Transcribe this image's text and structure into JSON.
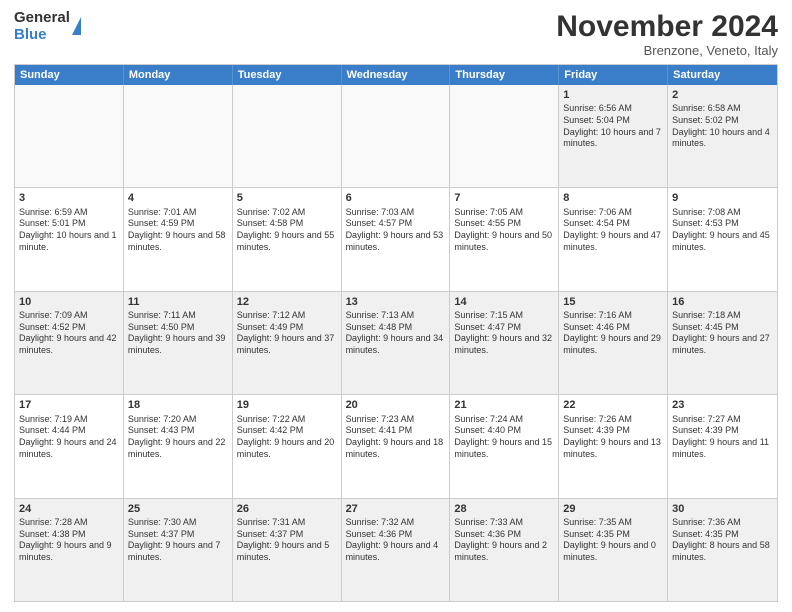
{
  "header": {
    "logo_general": "General",
    "logo_blue": "Blue",
    "month_title": "November 2024",
    "subtitle": "Brenzone, Veneto, Italy"
  },
  "calendar": {
    "days": [
      "Sunday",
      "Monday",
      "Tuesday",
      "Wednesday",
      "Thursday",
      "Friday",
      "Saturday"
    ],
    "rows": [
      [
        {
          "day": "",
          "info": ""
        },
        {
          "day": "",
          "info": ""
        },
        {
          "day": "",
          "info": ""
        },
        {
          "day": "",
          "info": ""
        },
        {
          "day": "",
          "info": ""
        },
        {
          "day": "1",
          "info": "Sunrise: 6:56 AM\nSunset: 5:04 PM\nDaylight: 10 hours and 7 minutes."
        },
        {
          "day": "2",
          "info": "Sunrise: 6:58 AM\nSunset: 5:02 PM\nDaylight: 10 hours and 4 minutes."
        }
      ],
      [
        {
          "day": "3",
          "info": "Sunrise: 6:59 AM\nSunset: 5:01 PM\nDaylight: 10 hours and 1 minute."
        },
        {
          "day": "4",
          "info": "Sunrise: 7:01 AM\nSunset: 4:59 PM\nDaylight: 9 hours and 58 minutes."
        },
        {
          "day": "5",
          "info": "Sunrise: 7:02 AM\nSunset: 4:58 PM\nDaylight: 9 hours and 55 minutes."
        },
        {
          "day": "6",
          "info": "Sunrise: 7:03 AM\nSunset: 4:57 PM\nDaylight: 9 hours and 53 minutes."
        },
        {
          "day": "7",
          "info": "Sunrise: 7:05 AM\nSunset: 4:55 PM\nDaylight: 9 hours and 50 minutes."
        },
        {
          "day": "8",
          "info": "Sunrise: 7:06 AM\nSunset: 4:54 PM\nDaylight: 9 hours and 47 minutes."
        },
        {
          "day": "9",
          "info": "Sunrise: 7:08 AM\nSunset: 4:53 PM\nDaylight: 9 hours and 45 minutes."
        }
      ],
      [
        {
          "day": "10",
          "info": "Sunrise: 7:09 AM\nSunset: 4:52 PM\nDaylight: 9 hours and 42 minutes."
        },
        {
          "day": "11",
          "info": "Sunrise: 7:11 AM\nSunset: 4:50 PM\nDaylight: 9 hours and 39 minutes."
        },
        {
          "day": "12",
          "info": "Sunrise: 7:12 AM\nSunset: 4:49 PM\nDaylight: 9 hours and 37 minutes."
        },
        {
          "day": "13",
          "info": "Sunrise: 7:13 AM\nSunset: 4:48 PM\nDaylight: 9 hours and 34 minutes."
        },
        {
          "day": "14",
          "info": "Sunrise: 7:15 AM\nSunset: 4:47 PM\nDaylight: 9 hours and 32 minutes."
        },
        {
          "day": "15",
          "info": "Sunrise: 7:16 AM\nSunset: 4:46 PM\nDaylight: 9 hours and 29 minutes."
        },
        {
          "day": "16",
          "info": "Sunrise: 7:18 AM\nSunset: 4:45 PM\nDaylight: 9 hours and 27 minutes."
        }
      ],
      [
        {
          "day": "17",
          "info": "Sunrise: 7:19 AM\nSunset: 4:44 PM\nDaylight: 9 hours and 24 minutes."
        },
        {
          "day": "18",
          "info": "Sunrise: 7:20 AM\nSunset: 4:43 PM\nDaylight: 9 hours and 22 minutes."
        },
        {
          "day": "19",
          "info": "Sunrise: 7:22 AM\nSunset: 4:42 PM\nDaylight: 9 hours and 20 minutes."
        },
        {
          "day": "20",
          "info": "Sunrise: 7:23 AM\nSunset: 4:41 PM\nDaylight: 9 hours and 18 minutes."
        },
        {
          "day": "21",
          "info": "Sunrise: 7:24 AM\nSunset: 4:40 PM\nDaylight: 9 hours and 15 minutes."
        },
        {
          "day": "22",
          "info": "Sunrise: 7:26 AM\nSunset: 4:39 PM\nDaylight: 9 hours and 13 minutes."
        },
        {
          "day": "23",
          "info": "Sunrise: 7:27 AM\nSunset: 4:39 PM\nDaylight: 9 hours and 11 minutes."
        }
      ],
      [
        {
          "day": "24",
          "info": "Sunrise: 7:28 AM\nSunset: 4:38 PM\nDaylight: 9 hours and 9 minutes."
        },
        {
          "day": "25",
          "info": "Sunrise: 7:30 AM\nSunset: 4:37 PM\nDaylight: 9 hours and 7 minutes."
        },
        {
          "day": "26",
          "info": "Sunrise: 7:31 AM\nSunset: 4:37 PM\nDaylight: 9 hours and 5 minutes."
        },
        {
          "day": "27",
          "info": "Sunrise: 7:32 AM\nSunset: 4:36 PM\nDaylight: 9 hours and 4 minutes."
        },
        {
          "day": "28",
          "info": "Sunrise: 7:33 AM\nSunset: 4:36 PM\nDaylight: 9 hours and 2 minutes."
        },
        {
          "day": "29",
          "info": "Sunrise: 7:35 AM\nSunset: 4:35 PM\nDaylight: 9 hours and 0 minutes."
        },
        {
          "day": "30",
          "info": "Sunrise: 7:36 AM\nSunset: 4:35 PM\nDaylight: 8 hours and 58 minutes."
        }
      ]
    ]
  }
}
